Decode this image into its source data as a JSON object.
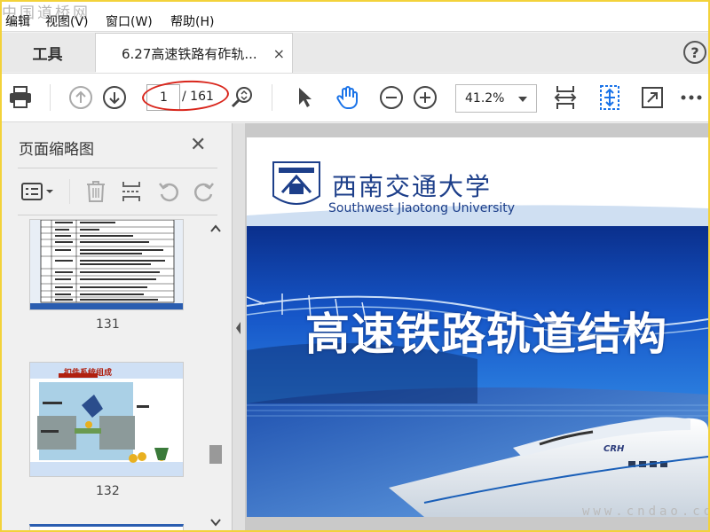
{
  "watermark_top": "中国道桥网",
  "menu": {
    "items": [
      "编辑",
      "视图(V)",
      "窗口(W)",
      "帮助(H)"
    ]
  },
  "tabs": {
    "tools_label": "工具",
    "document_label": "6.27高速铁路有砟轨...",
    "close_glyph": "×"
  },
  "help_glyph": "?",
  "toolbar": {
    "current_page": "1",
    "page_total": "/ 161",
    "zoom": "41.2%"
  },
  "sidebar": {
    "title": "页面缩略图",
    "close_glyph": "✕",
    "thumbnails": [
      {
        "label": "131"
      },
      {
        "label": "132",
        "heading": "扣件系统组成"
      }
    ]
  },
  "slide": {
    "university_cn": "西南交通大学",
    "university_en": "Southwest Jiaotong University",
    "title": "高速铁路轨道结构",
    "train_badge": "CRH"
  },
  "watermark_bottom": "www.cndao.com",
  "colors": {
    "accent_blue": "#1d3f8a",
    "slide_blue": "#1448b8",
    "highlight_red": "#d9261c",
    "frame_yellow": "#f3d23a",
    "active_icon_blue": "#1a73e8"
  }
}
